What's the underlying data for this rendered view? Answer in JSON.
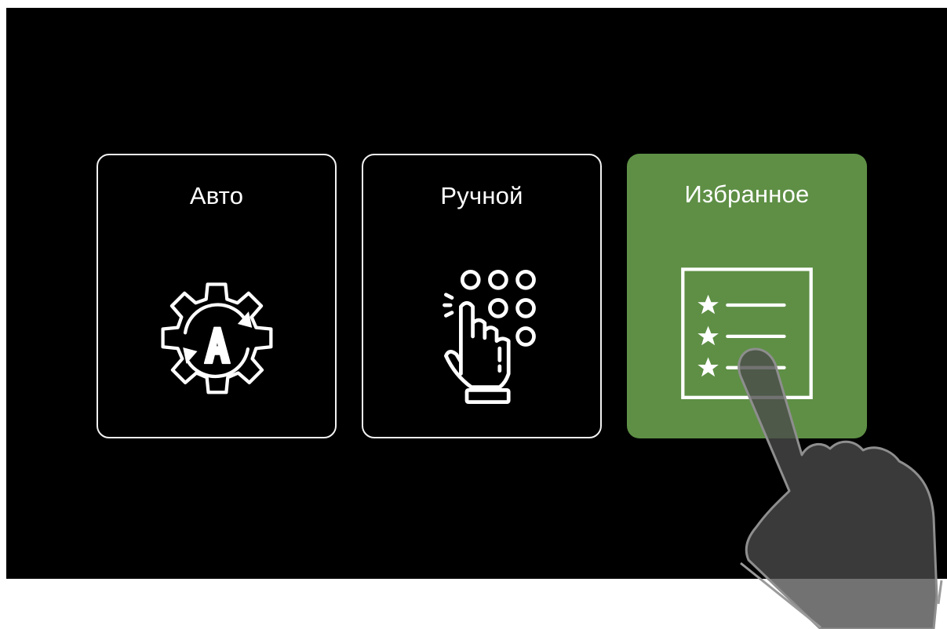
{
  "mode_selector": {
    "tiles": [
      {
        "label": "Авто",
        "icon": "gear-auto-icon",
        "selected": false
      },
      {
        "label": "Ручной",
        "icon": "keypad-hand-icon",
        "selected": false
      },
      {
        "label": "Избранное",
        "icon": "favorites-list-icon",
        "selected": true
      }
    ]
  },
  "colors": {
    "screen_background": "#000000",
    "tile_border": "#f2f2f2",
    "selected_tile": "#5e8f45",
    "label_text": "#ffffff",
    "pointer_hand": "#4a4a4a"
  },
  "overlay": {
    "icon": "pointing-hand-icon"
  }
}
